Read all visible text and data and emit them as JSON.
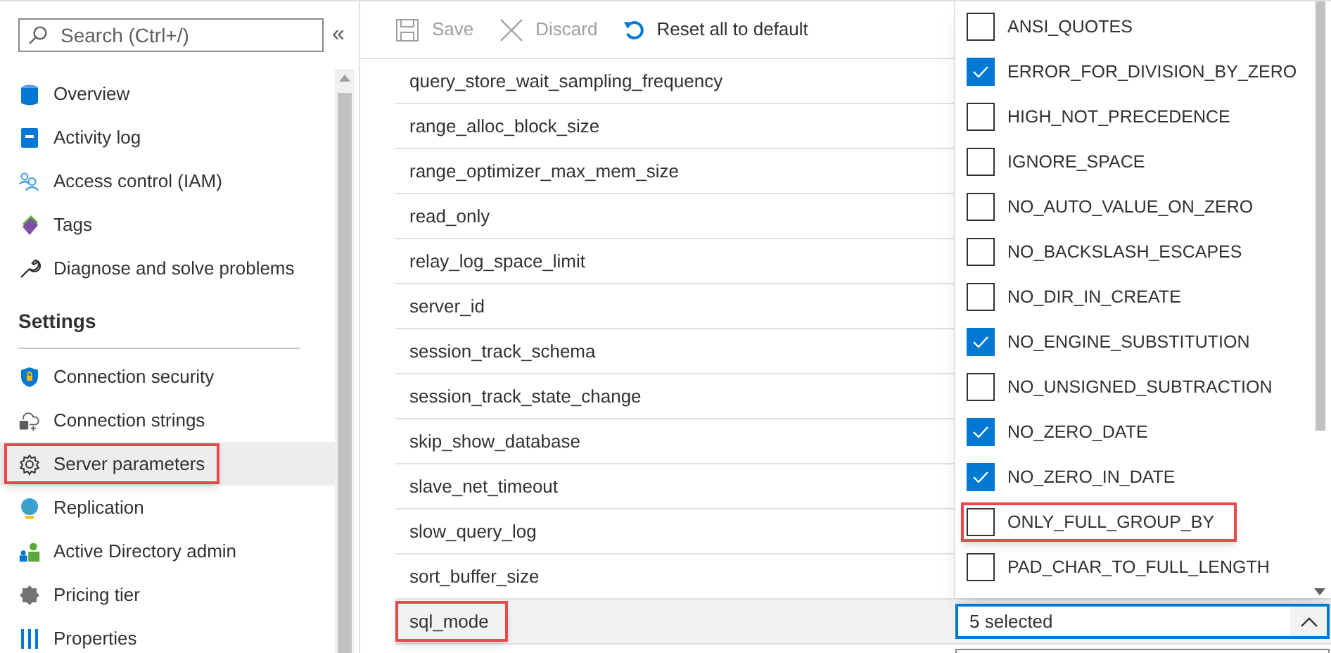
{
  "sidebar": {
    "search": {
      "placeholder": "Search (Ctrl+/)"
    },
    "collapse": "«",
    "items": [
      {
        "kind": "item",
        "label": "Overview",
        "selected": false,
        "highlighted": false
      },
      {
        "kind": "item",
        "label": "Activity log",
        "selected": false,
        "highlighted": false
      },
      {
        "kind": "item",
        "label": "Access control (IAM)",
        "selected": false,
        "highlighted": false
      },
      {
        "kind": "item",
        "label": "Tags",
        "selected": false,
        "highlighted": false
      },
      {
        "kind": "item",
        "label": "Diagnose and solve problems",
        "selected": false,
        "highlighted": false
      },
      {
        "kind": "heading",
        "label": "Settings"
      },
      {
        "kind": "item",
        "label": "Connection security",
        "selected": false,
        "highlighted": false
      },
      {
        "kind": "item",
        "label": "Connection strings",
        "selected": false,
        "highlighted": false
      },
      {
        "kind": "item",
        "label": "Server parameters",
        "selected": true,
        "highlighted": true
      },
      {
        "kind": "item",
        "label": "Replication",
        "selected": false,
        "highlighted": false
      },
      {
        "kind": "item",
        "label": "Active Directory admin",
        "selected": false,
        "highlighted": false
      },
      {
        "kind": "item",
        "label": "Pricing tier",
        "selected": false,
        "highlighted": false
      },
      {
        "kind": "item",
        "label": "Properties",
        "selected": false,
        "highlighted": false
      }
    ]
  },
  "toolbar": [
    {
      "label": "Save",
      "disabled": true
    },
    {
      "label": "Discard",
      "disabled": true
    },
    {
      "label": "Reset all to default",
      "disabled": false
    }
  ],
  "parameters": [
    {
      "name": "query_store_wait_sampling_frequency",
      "selected": false,
      "highlighted": false
    },
    {
      "name": "range_alloc_block_size",
      "selected": false,
      "highlighted": false
    },
    {
      "name": "range_optimizer_max_mem_size",
      "selected": false,
      "highlighted": false
    },
    {
      "name": "read_only",
      "selected": false,
      "highlighted": false
    },
    {
      "name": "relay_log_space_limit",
      "selected": false,
      "highlighted": false
    },
    {
      "name": "server_id",
      "selected": false,
      "highlighted": false
    },
    {
      "name": "session_track_schema",
      "selected": false,
      "highlighted": false
    },
    {
      "name": "session_track_state_change",
      "selected": false,
      "highlighted": false
    },
    {
      "name": "skip_show_database",
      "selected": false,
      "highlighted": false
    },
    {
      "name": "slave_net_timeout",
      "selected": false,
      "highlighted": false
    },
    {
      "name": "slow_query_log",
      "selected": false,
      "highlighted": false
    },
    {
      "name": "sort_buffer_size",
      "selected": false,
      "highlighted": false
    },
    {
      "name": "sql_mode",
      "selected": true,
      "highlighted": true
    }
  ],
  "sql_mode_dropdown": {
    "value": "5 selected",
    "expanded": true,
    "options": [
      {
        "label": "ANSI_QUOTES",
        "checked": false,
        "highlighted": false
      },
      {
        "label": "ERROR_FOR_DIVISION_BY_ZERO",
        "checked": true,
        "highlighted": false
      },
      {
        "label": "HIGH_NOT_PRECEDENCE",
        "checked": false,
        "highlighted": false
      },
      {
        "label": "IGNORE_SPACE",
        "checked": false,
        "highlighted": false
      },
      {
        "label": "NO_AUTO_VALUE_ON_ZERO",
        "checked": false,
        "highlighted": false
      },
      {
        "label": "NO_BACKSLASH_ESCAPES",
        "checked": false,
        "highlighted": false
      },
      {
        "label": "NO_DIR_IN_CREATE",
        "checked": false,
        "highlighted": false
      },
      {
        "label": "NO_ENGINE_SUBSTITUTION",
        "checked": true,
        "highlighted": false
      },
      {
        "label": "NO_UNSIGNED_SUBTRACTION",
        "checked": false,
        "highlighted": false
      },
      {
        "label": "NO_ZERO_DATE",
        "checked": true,
        "highlighted": false
      },
      {
        "label": "NO_ZERO_IN_DATE",
        "checked": true,
        "highlighted": false
      },
      {
        "label": "ONLY_FULL_GROUP_BY",
        "checked": false,
        "highlighted": true
      },
      {
        "label": "PAD_CHAR_TO_FULL_LENGTH",
        "checked": false,
        "highlighted": false
      }
    ]
  }
}
